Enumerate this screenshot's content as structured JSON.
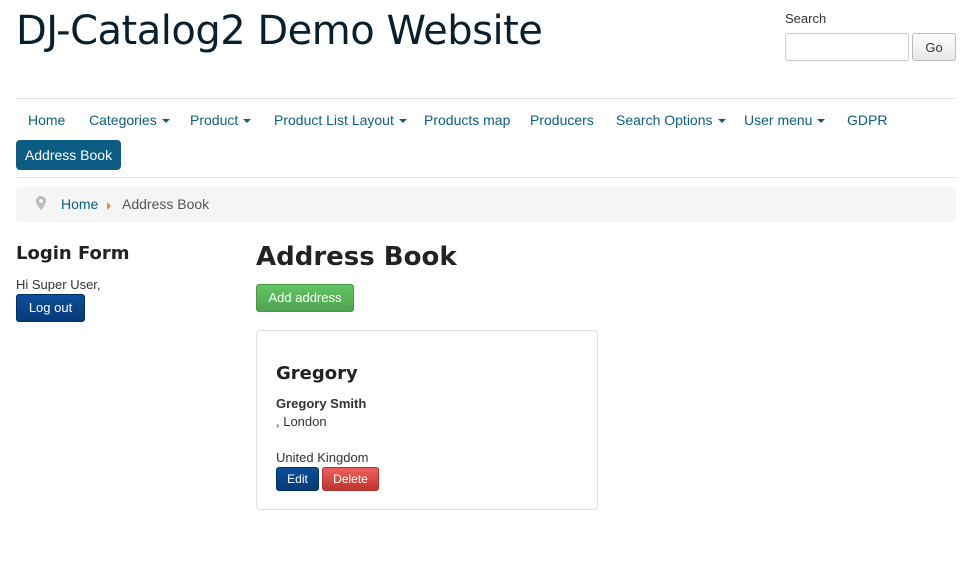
{
  "header": {
    "site_title": "DJ-Catalog2 Demo Website",
    "search_label": "Search",
    "search_value": "",
    "search_button": "Go"
  },
  "nav": {
    "items": [
      {
        "label": "Home",
        "dropdown": false
      },
      {
        "label": "Categories",
        "dropdown": true
      },
      {
        "label": "Product",
        "dropdown": true
      },
      {
        "label": "Product List Layout",
        "dropdown": true
      },
      {
        "label": "Products map",
        "dropdown": false
      },
      {
        "label": "Producers",
        "dropdown": false
      },
      {
        "label": "Search Options",
        "dropdown": true
      },
      {
        "label": "User menu",
        "dropdown": true
      },
      {
        "label": "GDPR",
        "dropdown": false
      }
    ],
    "active_label": "Address Book"
  },
  "breadcrumb": {
    "home": "Home",
    "current": "Address Book"
  },
  "sidebar": {
    "login_title": "Login Form",
    "greeting": "Hi Super User,",
    "logout_label": "Log out"
  },
  "main": {
    "title": "Address Book",
    "add_button": "Add address",
    "address": {
      "title": "Gregory",
      "full_name": "Gregory Smith",
      "city_line": ", London",
      "country": "United Kingdom",
      "edit_label": "Edit",
      "delete_label": "Delete"
    }
  },
  "colors": {
    "link": "#0d5f7f",
    "nav_active_bg": "#0b5d83",
    "primary_btn": "#0d4f9a",
    "success_btn": "#51a351",
    "danger_btn": "#bd362f",
    "breadcrumb_separator": "#e08a3c"
  },
  "icons": {
    "breadcrumb_pin": "map-pin-icon"
  }
}
